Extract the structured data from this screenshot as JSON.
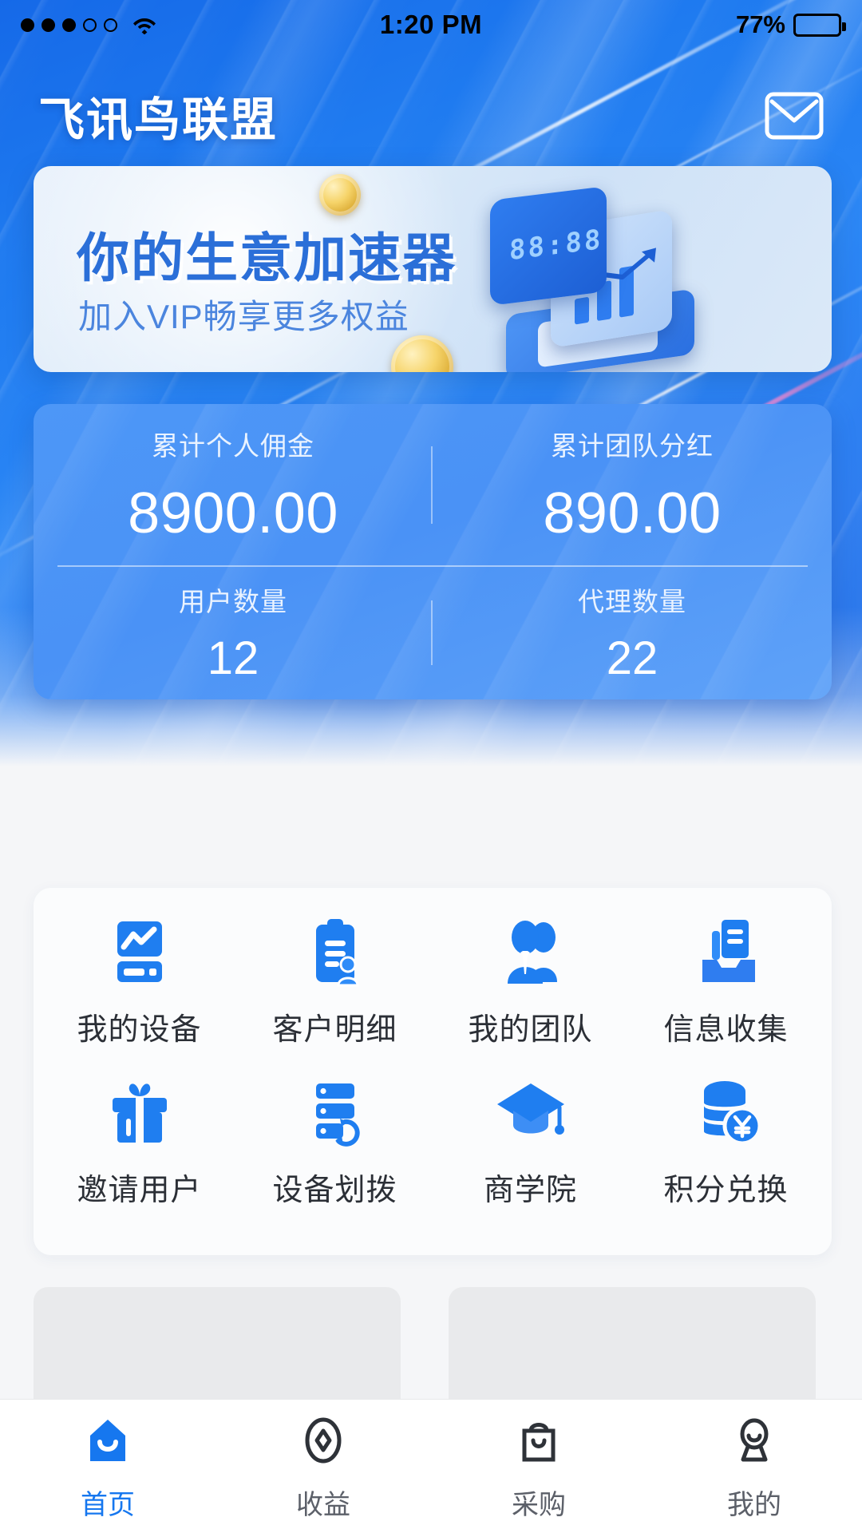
{
  "status_bar": {
    "signal_icon": "signal-dots-icon",
    "signal_dots_filled": 3,
    "signal_dots_total": 5,
    "wifi_icon": "wifi-icon",
    "time": "1:20 PM",
    "battery_text": "77%",
    "battery_percent": 77,
    "battery_icon": "battery-icon"
  },
  "header": {
    "brand": "飞讯鸟联盟",
    "mail_icon": "mail-envelope-icon"
  },
  "banner": {
    "title": "你的生意加速器",
    "subtitle": "加入VIP畅享更多权益",
    "device_digits": "88:88",
    "coin_icon": "gold-coin-icon",
    "device_icon": "device-dashboard-icon"
  },
  "stats": {
    "items": [
      {
        "label": "累计个人佣金",
        "value": "8900.00"
      },
      {
        "label": "累计团队分红",
        "value": "890.00"
      },
      {
        "label": "用户数量",
        "value": "12"
      },
      {
        "label": "代理数量",
        "value": "22"
      }
    ]
  },
  "menu": {
    "items": [
      {
        "label": "我的设备",
        "icon": "device-monitor-icon"
      },
      {
        "label": "客户明细",
        "icon": "clipboard-customer-icon"
      },
      {
        "label": "我的团队",
        "icon": "team-people-icon"
      },
      {
        "label": "信息收集",
        "icon": "inbox-document-icon"
      },
      {
        "label": "邀请用户",
        "icon": "gift-box-icon"
      },
      {
        "label": "设备划拨",
        "icon": "server-transfer-icon"
      },
      {
        "label": "商学院",
        "icon": "graduation-cap-icon"
      },
      {
        "label": "积分兑换",
        "icon": "coins-yuan-icon"
      }
    ]
  },
  "tabs": [
    {
      "label": "首页",
      "icon": "home-icon",
      "active": true
    },
    {
      "label": "收益",
      "icon": "diamond-earnings-icon",
      "active": false
    },
    {
      "label": "采购",
      "icon": "shopping-bag-icon",
      "active": false
    },
    {
      "label": "我的",
      "icon": "profile-person-icon",
      "active": false
    }
  ],
  "colors": {
    "accent": "#1677ef",
    "hero_blue": "#2a86f5",
    "stats_card": "#4d97f7",
    "page_bg": "#f5f6f8",
    "icon_blue": "#1f7ef0",
    "tab_inactive": "#5c6069"
  }
}
